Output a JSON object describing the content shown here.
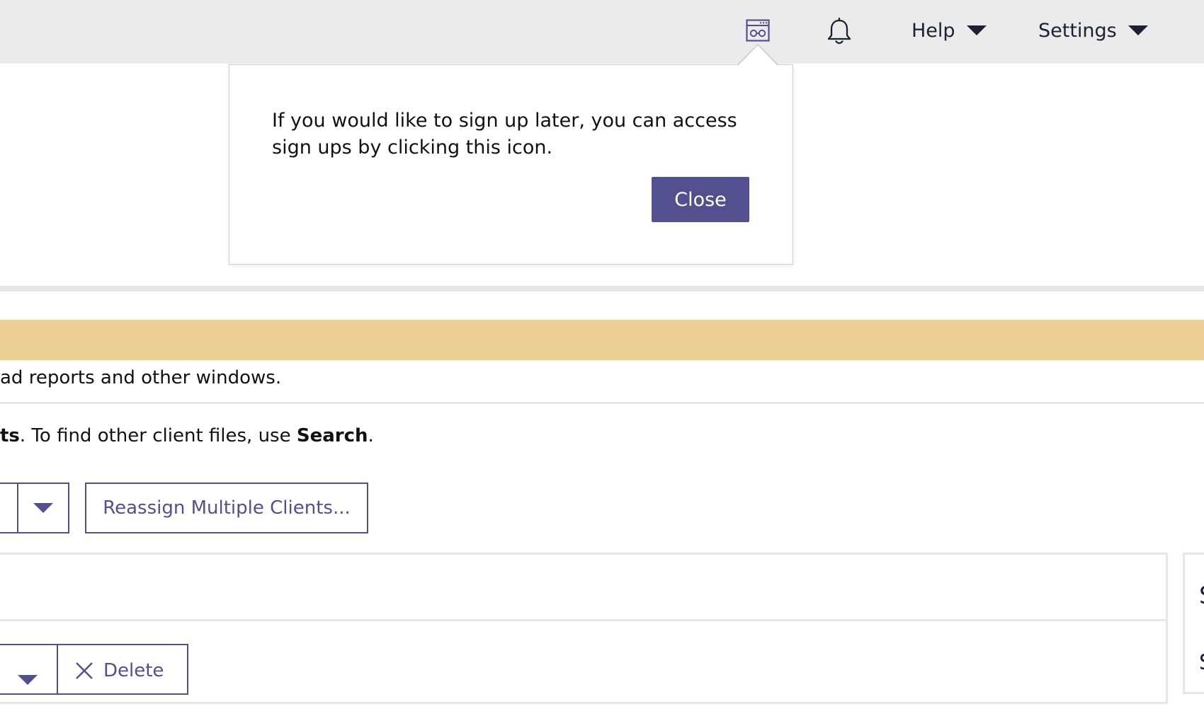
{
  "header": {
    "signups_icon": "signups-icon",
    "notifications_icon": "bell-icon",
    "help_label": "Help",
    "settings_label": "Settings"
  },
  "popover": {
    "message": "If you would like to sign up later, you can access sign ups by clicking this icon.",
    "close_label": "Close"
  },
  "notice": {
    "text": "ad reports and other windows."
  },
  "info": {
    "prefix": "ts",
    "middle": ". To find other client files, use ",
    "search_label": "Search",
    "suffix": "."
  },
  "toolbar": {
    "reassign_label": "Reassign Multiple Clients..."
  },
  "list_toolbar": {
    "delete_label": "Delete"
  },
  "side_panel": {
    "heading_glyph": "S",
    "row_glyph": "S"
  },
  "colors": {
    "accent": "#54508f",
    "warning": "#ebcf95",
    "topbar": "#ebebeb"
  }
}
